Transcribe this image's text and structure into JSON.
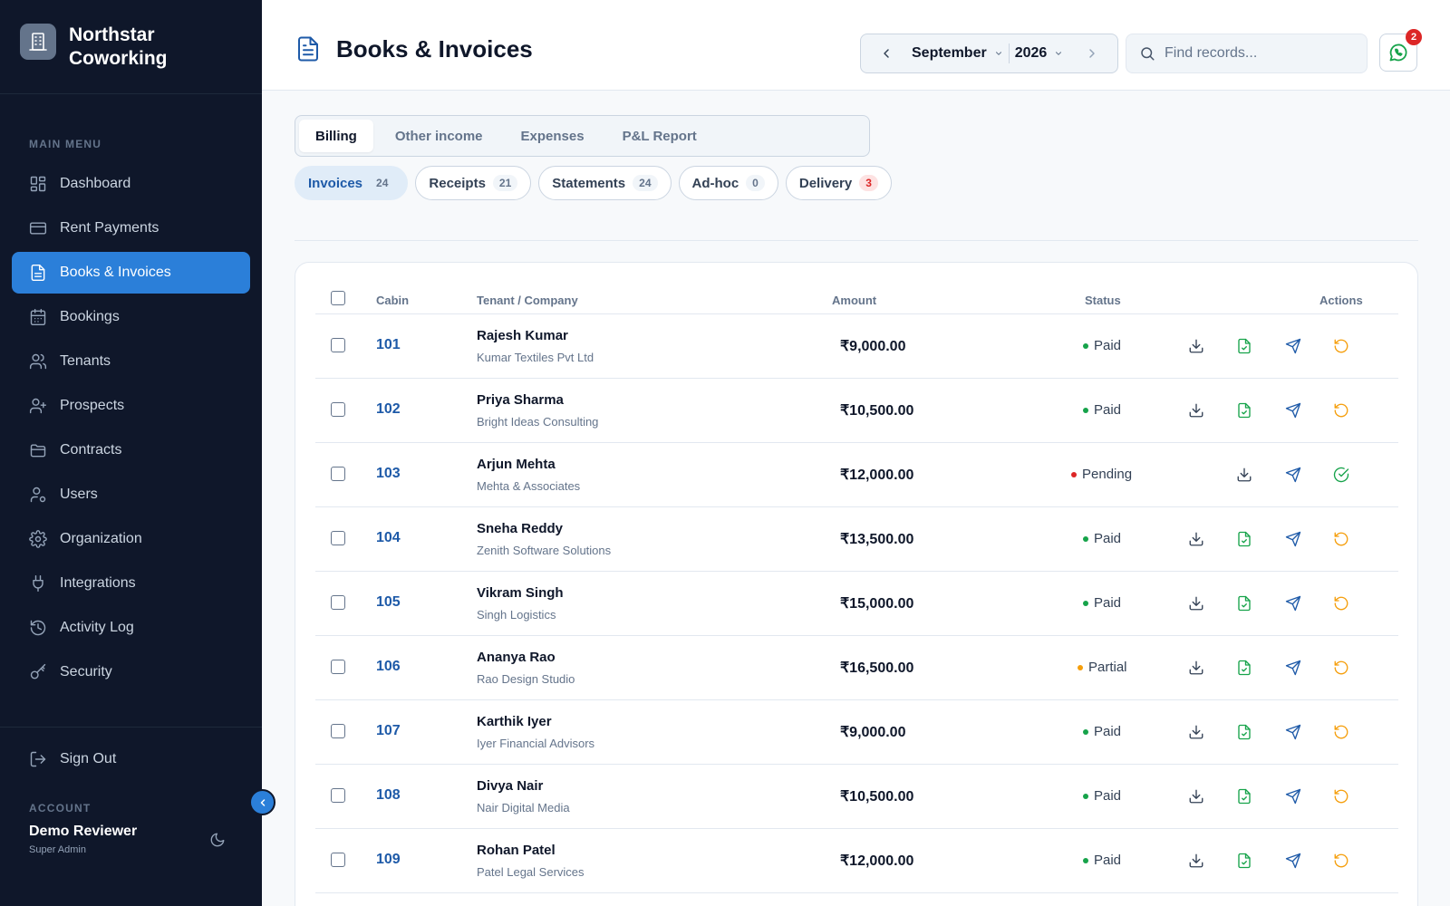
{
  "brand": {
    "name_line1": "Northstar",
    "name_line2": "Coworking"
  },
  "sidebar": {
    "menu_label": "MAIN MENU",
    "items": [
      {
        "label": "Dashboard",
        "icon": "dashboard-icon"
      },
      {
        "label": "Rent Payments",
        "icon": "card-icon"
      },
      {
        "label": "Books & Invoices",
        "icon": "document-icon",
        "active": true
      },
      {
        "label": "Bookings",
        "icon": "calendar-icon"
      },
      {
        "label": "Tenants",
        "icon": "users-icon"
      },
      {
        "label": "Prospects",
        "icon": "user-plus-icon"
      },
      {
        "label": "Contracts",
        "icon": "folder-icon"
      },
      {
        "label": "Users",
        "icon": "user-gear-icon"
      },
      {
        "label": "Organization",
        "icon": "gear-icon"
      },
      {
        "label": "Integrations",
        "icon": "plug-icon"
      },
      {
        "label": "Activity Log",
        "icon": "history-icon"
      },
      {
        "label": "Security",
        "icon": "key-icon"
      }
    ],
    "signout": "Sign Out",
    "account_label": "ACCOUNT",
    "account_name": "Demo Reviewer",
    "account_role": "Super Admin"
  },
  "header": {
    "title": "Books & Invoices",
    "month": "September",
    "year": "2026",
    "search_placeholder": "Find records...",
    "notification_count": "2"
  },
  "tabs": [
    {
      "label": "Billing",
      "active": true
    },
    {
      "label": "Other income"
    },
    {
      "label": "Expenses"
    },
    {
      "label": "P&L Report"
    }
  ],
  "pills": [
    {
      "label": "Invoices",
      "count": "24",
      "active": true
    },
    {
      "label": "Receipts",
      "count": "21"
    },
    {
      "label": "Statements",
      "count": "24"
    },
    {
      "label": "Ad-hoc",
      "count": "0"
    },
    {
      "label": "Delivery",
      "count": "3",
      "alert": true
    }
  ],
  "table": {
    "columns": {
      "cabin": "Cabin",
      "tenant": "Tenant / Company",
      "amount": "Amount",
      "status": "Status",
      "actions": "Actions"
    },
    "rows": [
      {
        "cabin": "101",
        "name": "Rajesh Kumar",
        "company": "Kumar Textiles Pvt Ltd",
        "amount": "₹9,000.00",
        "status": "Paid"
      },
      {
        "cabin": "102",
        "name": "Priya Sharma",
        "company": "Bright Ideas Consulting",
        "amount": "₹10,500.00",
        "status": "Paid"
      },
      {
        "cabin": "103",
        "name": "Arjun Mehta",
        "company": "Mehta & Associates",
        "amount": "₹12,000.00",
        "status": "Pending"
      },
      {
        "cabin": "104",
        "name": "Sneha Reddy",
        "company": "Zenith Software Solutions",
        "amount": "₹13,500.00",
        "status": "Paid"
      },
      {
        "cabin": "105",
        "name": "Vikram Singh",
        "company": "Singh Logistics",
        "amount": "₹15,000.00",
        "status": "Paid"
      },
      {
        "cabin": "106",
        "name": "Ananya Rao",
        "company": "Rao Design Studio",
        "amount": "₹16,500.00",
        "status": "Partial"
      },
      {
        "cabin": "107",
        "name": "Karthik Iyer",
        "company": "Iyer Financial Advisors",
        "amount": "₹9,000.00",
        "status": "Paid"
      },
      {
        "cabin": "108",
        "name": "Divya Nair",
        "company": "Nair Digital Media",
        "amount": "₹10,500.00",
        "status": "Paid"
      },
      {
        "cabin": "109",
        "name": "Rohan Patel",
        "company": "Patel Legal Services",
        "amount": "₹12,000.00",
        "status": "Paid"
      }
    ]
  },
  "colors": {
    "accent": "#2b7fd9",
    "paid": "#16a34a",
    "pending": "#dc2626",
    "partial": "#f59e0b",
    "restore": "#f59e0b"
  }
}
